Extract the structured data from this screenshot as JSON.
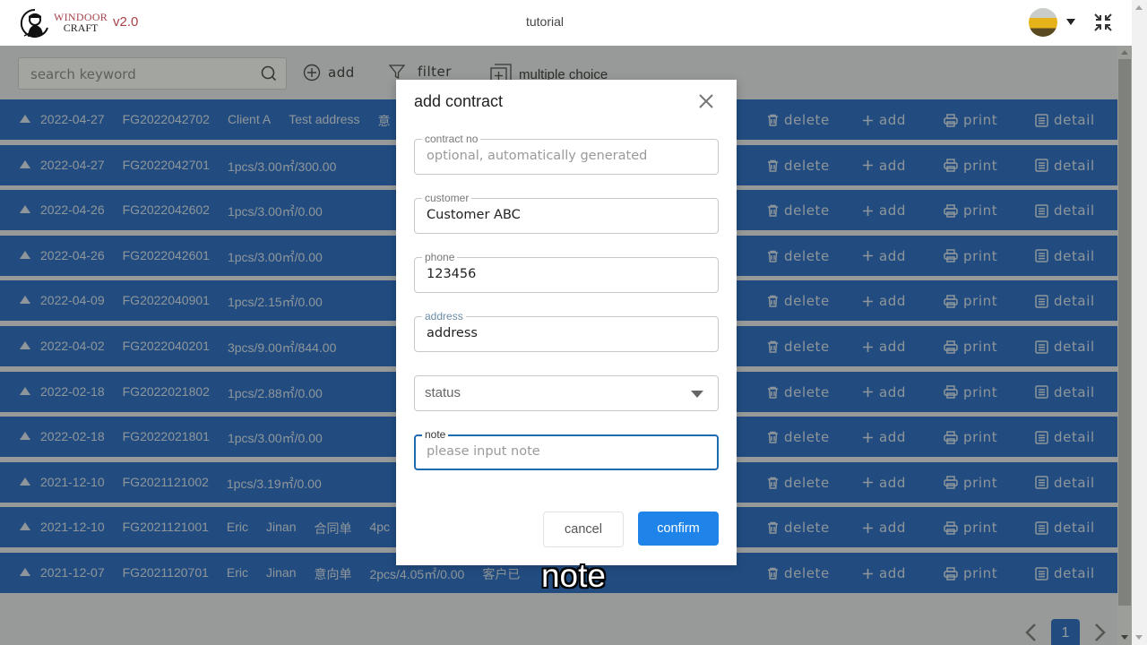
{
  "header": {
    "logo_line1": "WINDOOR",
    "logo_line2": "CRAFT",
    "version": "v2.0",
    "title": "tutorial",
    "avatar_icon": "user-avatar",
    "account_caret_icon": "caret-down-icon",
    "exit_fullscreen_icon": "shrink-icon"
  },
  "toolbar": {
    "search_placeholder": "search keyword",
    "search_value": "",
    "add_label": "add",
    "filter_label": "filter",
    "multiple_choice_label": "multiple choice"
  },
  "row_actions": {
    "delete": "delete",
    "add": "add",
    "print": "print",
    "detail": "detail"
  },
  "rows": [
    {
      "cells": [
        "2022-04-27",
        "FG2022042702",
        "Client A",
        "Test address",
        "意"
      ]
    },
    {
      "cells": [
        "2022-04-27",
        "FG2022042701",
        "1pcs/3.00㎡/300.00"
      ]
    },
    {
      "cells": [
        "2022-04-26",
        "FG2022042602",
        "1pcs/3.00㎡/0.00"
      ]
    },
    {
      "cells": [
        "2022-04-26",
        "FG2022042601",
        "1pcs/3.00㎡/0.00"
      ]
    },
    {
      "cells": [
        "2022-04-09",
        "FG2022040901",
        "1pcs/2.15㎡/0.00"
      ]
    },
    {
      "cells": [
        "2022-04-02",
        "FG2022040201",
        "3pcs/9.00㎡/844.00"
      ]
    },
    {
      "cells": [
        "2022-02-18",
        "FG2022021802",
        "1pcs/2.88㎡/0.00"
      ]
    },
    {
      "cells": [
        "2022-02-18",
        "FG2022021801",
        "1pcs/3.00㎡/0.00"
      ]
    },
    {
      "cells": [
        "2021-12-10",
        "FG2021121002",
        "1pcs/3.19㎡/0.00"
      ]
    },
    {
      "cells": [
        "2021-12-10",
        "FG2021121001",
        "Eric",
        "Jinan",
        "合同单",
        "4pc"
      ]
    },
    {
      "cells": [
        "2021-12-07",
        "FG2021120701",
        "Eric",
        "Jinan",
        "意向单",
        "2pcs/4.05㎡/0.00",
        "客户已"
      ]
    }
  ],
  "pagination": {
    "current_page": "1",
    "prev_icon": "chevron-left-icon",
    "next_icon": "chevron-right-icon"
  },
  "dialog": {
    "title": "add contract",
    "fields": {
      "contract_no": {
        "label": "contract no",
        "value": "",
        "placeholder": "optional, automatically generated"
      },
      "customer": {
        "label": "customer",
        "value": "Customer ABC",
        "placeholder": ""
      },
      "phone": {
        "label": "phone",
        "value": "123456",
        "placeholder": ""
      },
      "address": {
        "label": "address",
        "value": "address",
        "placeholder": ""
      },
      "status": {
        "label": "status",
        "value": "status"
      },
      "note": {
        "label": "note",
        "value": "",
        "placeholder": "please input note"
      }
    },
    "cancel_label": "cancel",
    "confirm_label": "confirm"
  },
  "caption": "note",
  "colors": {
    "row_blue": "#2166c6",
    "confirm_blue": "#1e84ea",
    "focus_border": "#1f6bb0",
    "brand_red": "#a5414a"
  }
}
